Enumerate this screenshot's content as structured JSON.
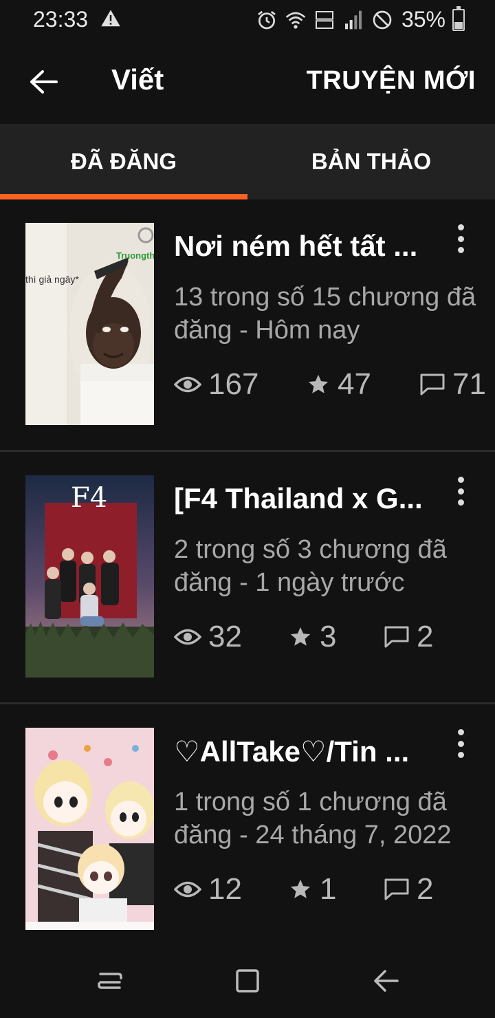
{
  "status_bar": {
    "time": "23:33",
    "battery": "35%",
    "battery_level": 0.35,
    "icons": [
      "warning-icon",
      "alarm-icon",
      "wifi-icon",
      "volte-icon",
      "signal-icon",
      "dnd-icon",
      "battery-icon"
    ]
  },
  "app_bar": {
    "title": "Viết",
    "new_story": "TRUYỆN MỚI"
  },
  "tabs": [
    {
      "label": "ĐÃ ĐĂNG",
      "active": true
    },
    {
      "label": "BẢN THẢO",
      "active": false
    }
  ],
  "stories": [
    {
      "title": "Nơi ném hết tất ...",
      "meta": "13 trong số 15 chương đã đăng - Hôm nay",
      "views": "167",
      "votes": "47",
      "comments": "71",
      "cover_text": "thì giả ngây*",
      "cover_watermark": "Truongth"
    },
    {
      "title": "[F4 Thailand x G...",
      "meta": "2 trong số 3 chương đã đăng - 1 ngày trước",
      "views": "32",
      "votes": "3",
      "comments": "2",
      "cover_text": "F4"
    },
    {
      "title": "♡AllTake♡/Tin ...",
      "meta": "1 trong số 1 chương đã đăng - 24 tháng 7, 2022",
      "views": "12",
      "votes": "1",
      "comments": "2"
    }
  ],
  "colors": {
    "accent": "#ff6122",
    "background": "#121212",
    "tab_bar": "#222222",
    "meta_text": "#a8a8a8"
  }
}
